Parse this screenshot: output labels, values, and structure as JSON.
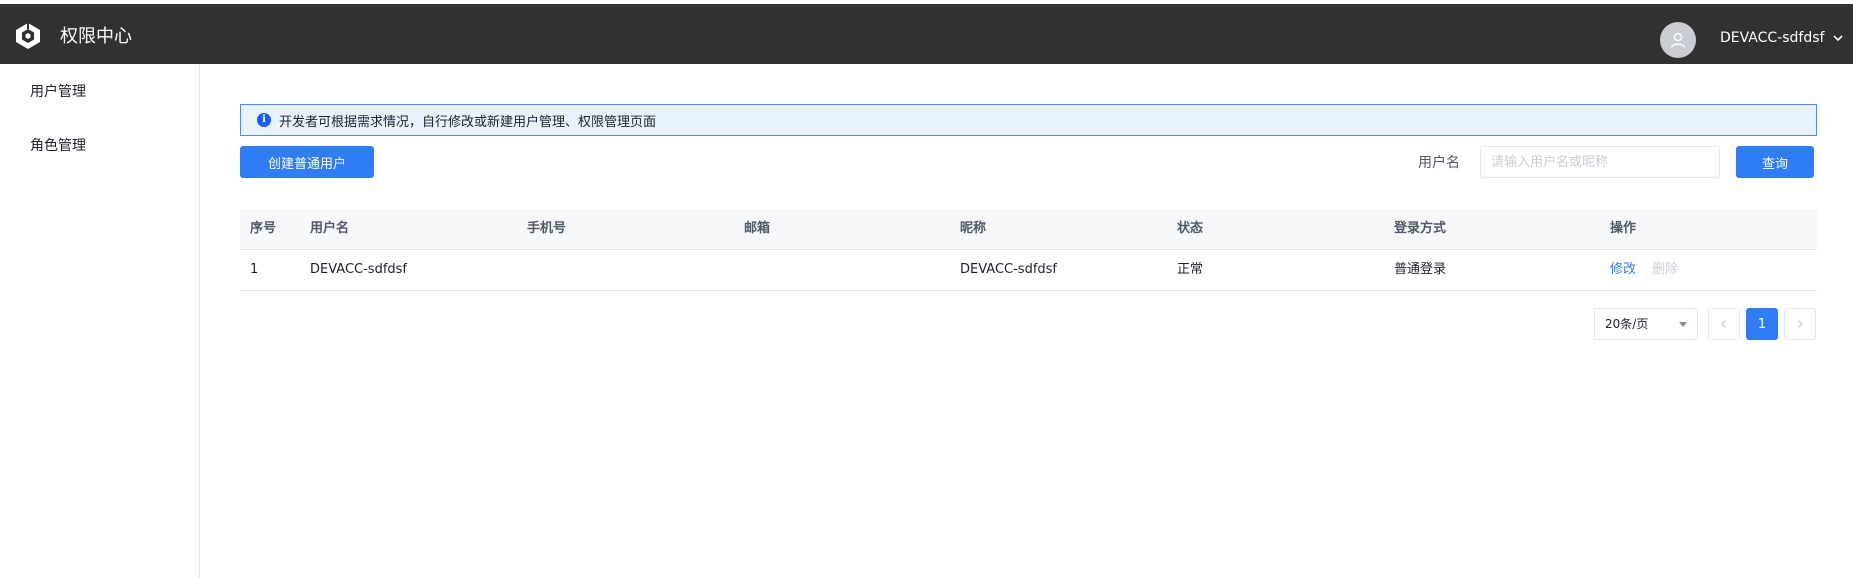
{
  "header": {
    "app_title": "权限中心",
    "logo_icon": "shield-cube-icon",
    "user_name": "DEVACC-sdfdsf"
  },
  "sidebar": {
    "items": [
      {
        "label": "用户管理"
      },
      {
        "label": "角色管理"
      }
    ]
  },
  "notice": {
    "text": "开发者可根据需求情况，自行修改或新建用户管理、权限管理页面"
  },
  "toolbar": {
    "create_label": "创建普通用户",
    "filter_label": "用户名",
    "filter_placeholder": "请输入用户名或昵称",
    "filter_value": "",
    "query_label": "查询"
  },
  "table": {
    "columns": [
      "序号",
      "用户名",
      "手机号",
      "邮箱",
      "昵称",
      "状态",
      "登录方式",
      "操作"
    ],
    "rows": [
      {
        "index": "1",
        "username": "DEVACC-sdfdsf",
        "phone": "",
        "email": "",
        "nickname": "DEVACC-sdfdsf",
        "status": "正常",
        "login_method": "普通登录",
        "action_edit": "修改",
        "action_delete": "删除"
      }
    ]
  },
  "pagination": {
    "page_size": "20条/页",
    "current_page": "1"
  },
  "colors": {
    "topbar": "#313131",
    "primary": "#2f7df6",
    "notice_bg": "#e8f3ff"
  }
}
